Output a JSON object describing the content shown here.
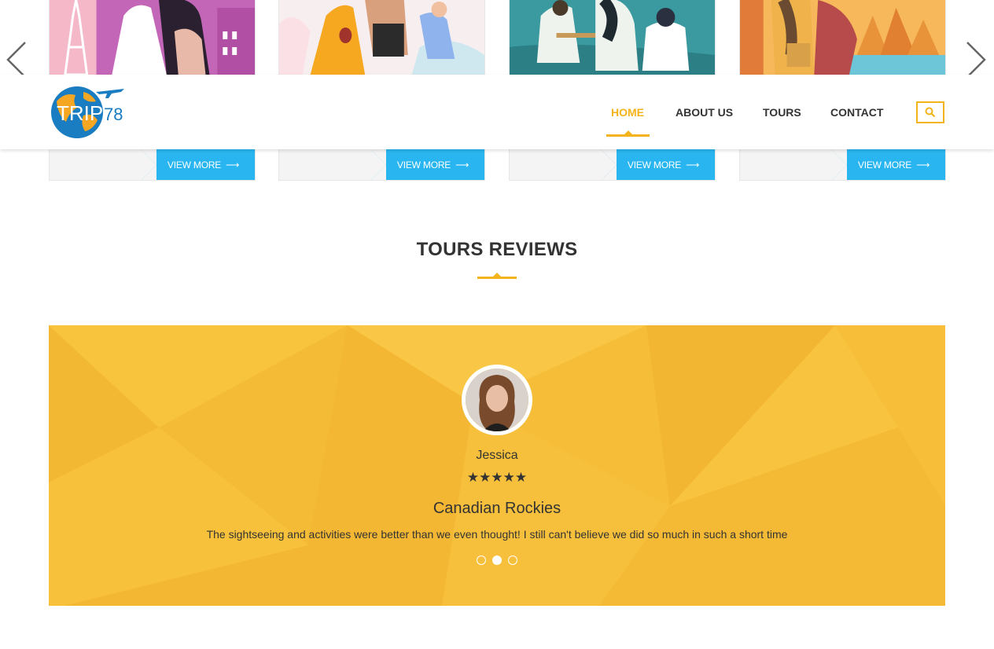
{
  "cards": [
    {
      "view_more": "VIEW MORE",
      "image": "paris-couple-illustration"
    },
    {
      "view_more": "VIEW MORE",
      "image": "family-beach-illustration"
    },
    {
      "view_more": "VIEW MORE",
      "image": "friends-campfire-illustration"
    },
    {
      "view_more": "VIEW MORE",
      "image": "autumn-hikers-illustration"
    }
  ],
  "nav": {
    "logo_text": "TRIP",
    "logo_number": "78",
    "items": [
      "HOME",
      "ABOUT US",
      "TOURS",
      "CONTACT"
    ],
    "active": "HOME",
    "search_icon": "search-icon"
  },
  "reviews": {
    "title": "TOURS REVIEWS",
    "reviewer": "Jessica",
    "stars": "★★★★★",
    "rating": 5,
    "tour": "Canadian Rockies",
    "quote": "The sightseeing and activities were better than we even thought! I still can't believe we did so much in such a short time",
    "slide_count": 3,
    "active_slide": 2
  },
  "colors": {
    "accent": "#f3b31b",
    "button": "#29b6f0",
    "review_bg": "#f6bd35"
  }
}
